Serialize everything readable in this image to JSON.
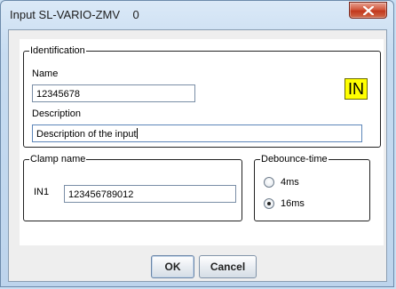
{
  "window": {
    "title": "Input SL-VARIO-ZMV    0",
    "close_icon": "close-icon"
  },
  "identification": {
    "legend": "Identification",
    "name_label": "Name",
    "name_value": "12345678",
    "description_label": "Description",
    "description_value": "Description of the input",
    "badge": "IN",
    "badge_color": "#ffff00"
  },
  "clamp": {
    "legend": "Clamp name",
    "label": "IN1",
    "value": "123456789012"
  },
  "debounce": {
    "legend": "Debounce-time",
    "options": [
      {
        "label": "4ms",
        "selected": false
      },
      {
        "label": "16ms",
        "selected": true
      }
    ]
  },
  "buttons": {
    "ok": "OK",
    "cancel": "Cancel"
  }
}
